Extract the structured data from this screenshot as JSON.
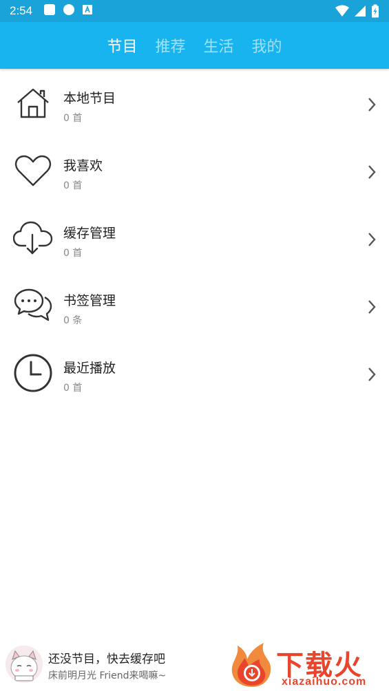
{
  "status_bar": {
    "time": "2:54"
  },
  "tabs": [
    {
      "label": "节目",
      "active": true
    },
    {
      "label": "推荐",
      "active": false
    },
    {
      "label": "生活",
      "active": false
    },
    {
      "label": "我的",
      "active": false
    }
  ],
  "items": [
    {
      "icon": "home-icon",
      "title": "本地节目",
      "sub": "0 首"
    },
    {
      "icon": "heart-icon",
      "title": "我喜欢",
      "sub": "0 首"
    },
    {
      "icon": "cloud-download-icon",
      "title": "缓存管理",
      "sub": "0 首"
    },
    {
      "icon": "chat-bubble-icon",
      "title": "书签管理",
      "sub": "0 条"
    },
    {
      "icon": "clock-icon",
      "title": "最近播放",
      "sub": "0 首"
    }
  ],
  "player": {
    "title": "还没节目，快去缓存吧",
    "subtitle": "床前明月光 Friend来喝嘛~"
  },
  "watermark": {
    "text": "下载火",
    "url": "xiazaihuo.com"
  },
  "colors": {
    "header": "#17b4f0",
    "status_bar": "#1aa3d9",
    "watermark": "#e8452c"
  }
}
